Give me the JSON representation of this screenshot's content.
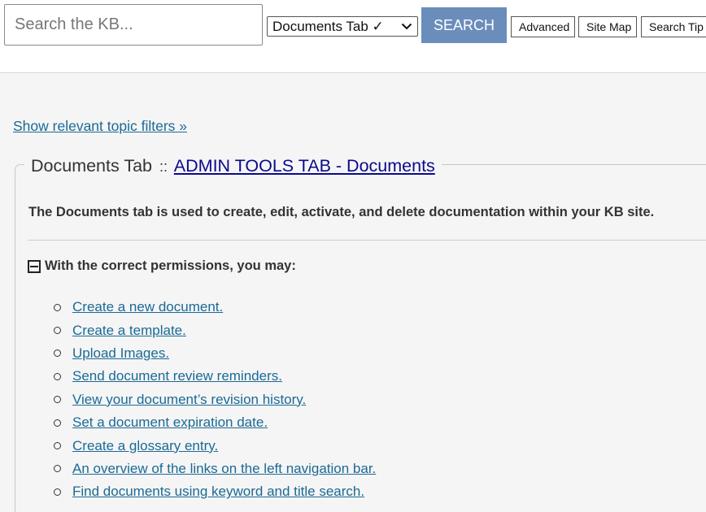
{
  "search": {
    "placeholder": "Search the KB...",
    "scope_value": "Documents Tab ✓",
    "button_label": "SEARCH"
  },
  "toolbar": {
    "advanced_label": "Advanced",
    "sitemap_label": "Site Map",
    "searchtip_label": "Search Tip"
  },
  "topic_filter_link": "Show relevant topic filters »",
  "section": {
    "title": "Documents Tab",
    "separator": "::",
    "crumb_link": "ADMIN TOOLS TAB - Documents"
  },
  "intro_text": "The Documents tab is used to create, edit, activate, and delete documentation within your KB site.",
  "permissions": {
    "heading": "With the correct permissions, you may:",
    "items": [
      "Create a new document.",
      "Create a template.",
      "Upload Images.",
      "Send document review reminders.",
      "View your document’s revision history.",
      "Set a document expiration date.",
      "Create a glossary entry.",
      "An overview of the links on the left navigation bar.",
      "Find documents using keyword and title search."
    ]
  },
  "colors": {
    "search_button": "#6a8dbb",
    "link": "#1a6a96",
    "crumb_link": "#0a0a8c",
    "background": "#f5f5f5"
  }
}
